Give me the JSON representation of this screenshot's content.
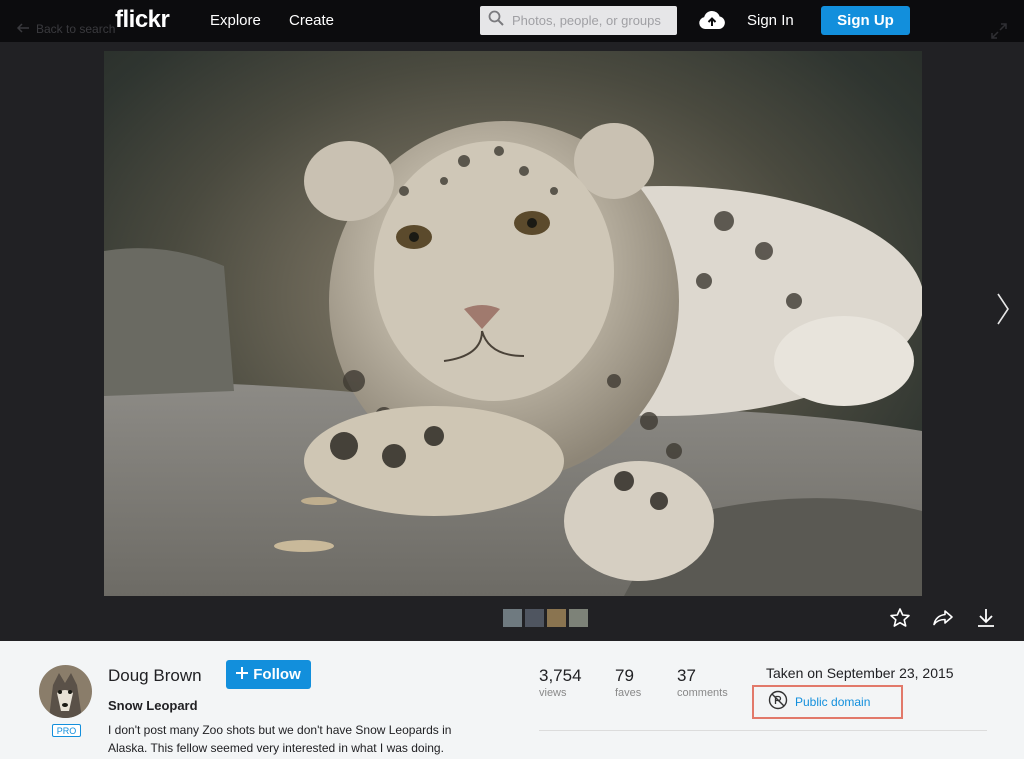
{
  "nav": {
    "back_label": "Back to search",
    "logo": "flickr",
    "explore": "Explore",
    "create": "Create",
    "search_placeholder": "Photos, people, or groups",
    "sign_in": "Sign In",
    "sign_up": "Sign Up"
  },
  "photo": {
    "alt": "Snow leopard lying on a rock",
    "thumb_count": 4
  },
  "owner": {
    "name": "Doug Brown",
    "pro_badge": "PRO",
    "follow_label": "Follow"
  },
  "details": {
    "title": "Snow Leopard",
    "description": "I don't post many Zoo shots but we don't have Snow Leopards in Alaska. This fellow seemed very interested in what I was doing.",
    "taken": "Taken on September 23, 2015",
    "license": "Public domain"
  },
  "stats": {
    "views": "3,754",
    "views_label": "views",
    "faves": "79",
    "faves_label": "faves",
    "comments": "37",
    "comments_label": "comments"
  },
  "colors": {
    "accent": "#128fdc",
    "highlight_border": "#e2796a",
    "nav_bg": "#0c0c0e",
    "viewer_bg": "#212124"
  }
}
